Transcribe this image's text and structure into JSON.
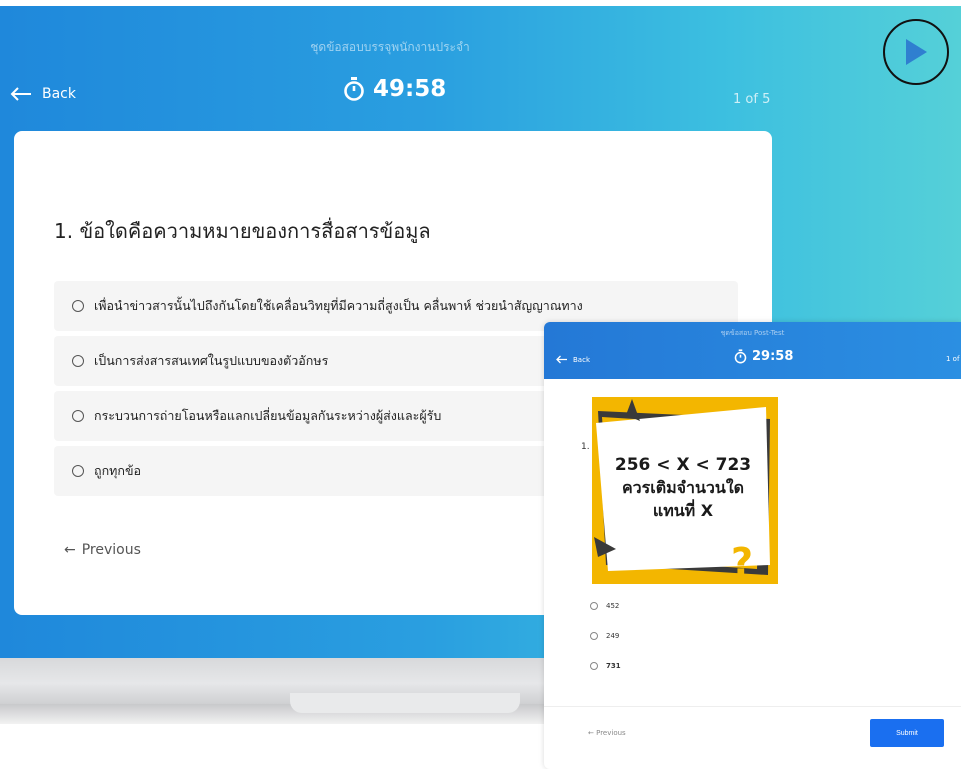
{
  "main": {
    "title": "ชุดข้อสอบบรรจุพนักงานประจำ",
    "back_label": "Back",
    "timer": "49:58",
    "counter": "1 of 5",
    "question": "1.  ข้อใดคือความหมายของการสื่อสารข้อมูล",
    "options": [
      "เพื่อนำข่าวสารนั้นไปถึงกันโดยใช้เคลื่อนวิทยุที่มีความถี่สูงเป็น คลื่นพาห์ ช่วยนำสัญญาณทาง",
      "เป็นการส่งสารสนเทศในรูปแบบของตัวอักษร",
      "กระบวนการถ่ายโอนหรือแลกเปลี่ยนข้อมูลกันระหว่างผู้ส่งและผู้รับ",
      "ถูกทุกข้อ"
    ],
    "previous_label": "Previous"
  },
  "tablet": {
    "title": "ชุดข้อสอบ Post-Test",
    "back_label": "Back",
    "timer": "29:58",
    "counter": "1 of",
    "question_number": "1.",
    "image_text": [
      "256 < X < 723",
      "ควรเติมจำนวนใด",
      "แทนที่ X"
    ],
    "image_mark": "?",
    "options": [
      "452",
      "249",
      "731"
    ],
    "previous_label": "Previous",
    "submit_label": "Submit"
  },
  "colors": {
    "header_gradient_start": "#1f88db",
    "header_gradient_end": "#55d0d8",
    "tablet_header": "#2478d6",
    "submit_button": "#1a6ff0",
    "puzzle_yellow": "#f3b600",
    "play_icon": "#2f7fd0"
  },
  "icons": [
    "back-arrow-icon",
    "stopwatch-icon",
    "play-icon",
    "radio-icon",
    "previous-arrow-icon"
  ]
}
